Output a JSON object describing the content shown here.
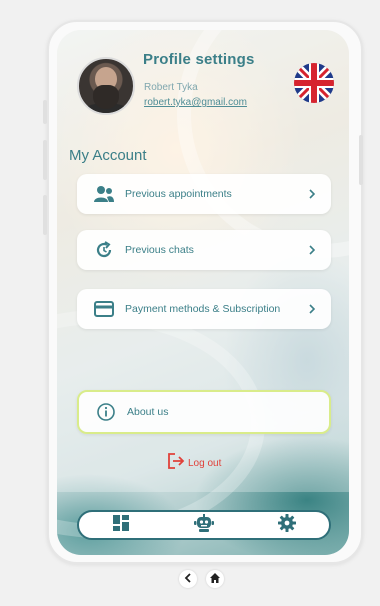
{
  "profile": {
    "title": "Profile settings",
    "name": "Robert Tyka",
    "email": "robert.tyka@gmail.com"
  },
  "language": {
    "icon": "uk-flag-icon"
  },
  "account": {
    "section_title": "My Account",
    "items": [
      {
        "label": "Previous appointments",
        "icon": "people-icon"
      },
      {
        "label": "Previous chats",
        "icon": "chat-history-icon"
      },
      {
        "label": "Payment methods & Subscription",
        "icon": "credit-card-icon"
      }
    ]
  },
  "about": {
    "label": "About us",
    "icon": "info-icon"
  },
  "logout": {
    "label": "Log out",
    "icon": "logout-icon"
  },
  "tabbar": {
    "items": [
      {
        "icon": "dashboard-icon"
      },
      {
        "icon": "robot-icon"
      },
      {
        "icon": "gear-icon"
      }
    ]
  },
  "system_nav": {
    "back_icon": "back-chevron-icon",
    "home_icon": "home-icon"
  },
  "colors": {
    "accent": "#3b7f88",
    "logout": "#e0413a",
    "about_border": "#d9ec8a",
    "tabbar_border": "#2f6f79"
  }
}
